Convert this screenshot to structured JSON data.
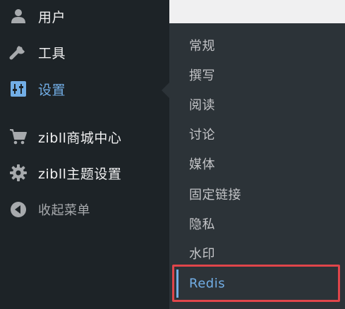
{
  "sidebar": {
    "items": [
      {
        "label": "用户",
        "icon": "user-icon"
      },
      {
        "label": "工具",
        "icon": "wrench-icon"
      },
      {
        "label": "设置",
        "icon": "settings-sliders-icon",
        "active": true
      },
      {
        "label": "zibll商城中心",
        "icon": "cart-icon"
      },
      {
        "label": "zibll主题设置",
        "icon": "gear-icon"
      },
      {
        "label": "收起菜单",
        "icon": "collapse-arrow-icon"
      }
    ]
  },
  "submenu": {
    "items": [
      {
        "label": "常规"
      },
      {
        "label": "撰写"
      },
      {
        "label": "阅读"
      },
      {
        "label": "讨论"
      },
      {
        "label": "媒体"
      },
      {
        "label": "固定链接"
      },
      {
        "label": "隐私"
      },
      {
        "label": "水印"
      },
      {
        "label": "Redis",
        "current": true
      }
    ]
  },
  "colors": {
    "sidebar_bg": "#1d2327",
    "submenu_bg": "#2c3338",
    "accent": "#72aee6",
    "highlight_border": "#e0454a",
    "content_bg": "#f0f0f1"
  }
}
